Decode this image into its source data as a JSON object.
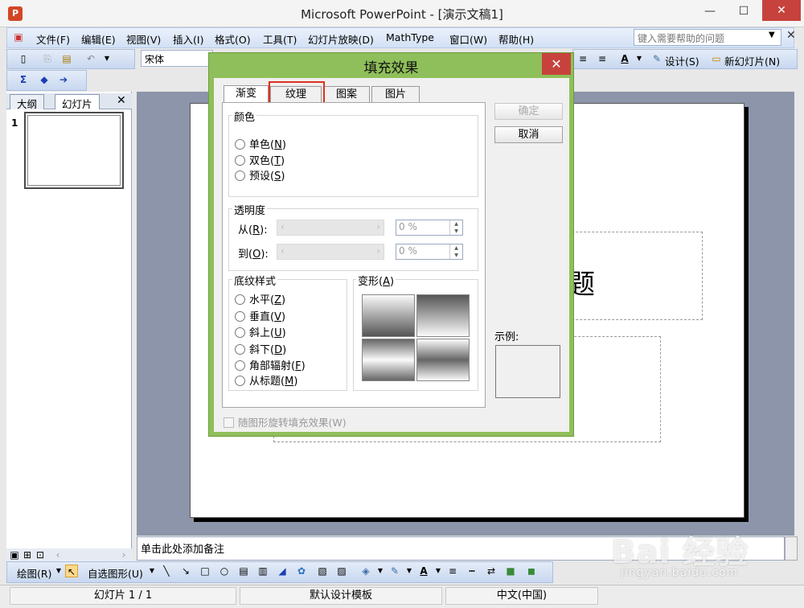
{
  "window": {
    "title": "Microsoft PowerPoint - [演示文稿1]",
    "minimize": "—",
    "maximize": "☐",
    "close": "✕"
  },
  "menu": {
    "items": [
      "文件(F)",
      "编辑(E)",
      "视图(V)",
      "插入(I)",
      "格式(O)",
      "工具(T)",
      "幻灯片放映(D)",
      "MathType",
      "窗口(W)",
      "帮助(H)"
    ],
    "help_placeholder": "键入需要帮助的问题",
    "close": "✕"
  },
  "toolbar": {
    "font_name": "宋体",
    "design_label": "设计(S)",
    "new_slide_label": "新幻灯片(N)",
    "sigma": "Σ"
  },
  "left_panel": {
    "tab_outline": "大纲",
    "tab_slides": "幻灯片",
    "close": "✕",
    "slide_number": "1"
  },
  "slide": {
    "title_fragment": "题"
  },
  "notes": {
    "text": "单击此处添加备注"
  },
  "drawbar": {
    "draw_label": "绘图(R)",
    "autoshape_label": "自选图形(U)"
  },
  "status": {
    "slide_info": "幻灯片 1 / 1",
    "template": "默认设计模板",
    "language": "中文(中国)"
  },
  "dialog": {
    "title": "填充效果",
    "close": "✕",
    "tabs": [
      "渐变",
      "纹理",
      "图案",
      "图片"
    ],
    "active_tab": "渐变",
    "highlighted_tab": "纹理",
    "color_group": {
      "label": "颜色",
      "options": [
        {
          "text": "单色",
          "key": "N"
        },
        {
          "text": "双色",
          "key": "T"
        },
        {
          "text": "预设",
          "key": "S"
        }
      ]
    },
    "transparency": {
      "label": "透明度",
      "from_label": "从",
      "from_key": "R",
      "to_label": "到",
      "to_key": "O",
      "from_value": "0 %",
      "to_value": "0 %"
    },
    "shading_group": {
      "label": "底纹样式",
      "options": [
        {
          "text": "水平",
          "key": "Z"
        },
        {
          "text": "垂直",
          "key": "V"
        },
        {
          "text": "斜上",
          "key": "U"
        },
        {
          "text": "斜下",
          "key": "D"
        },
        {
          "text": "角部辐射",
          "key": "F"
        },
        {
          "text": "从标题",
          "key": "M"
        }
      ]
    },
    "variants": {
      "label": "变形",
      "key": "A"
    },
    "ok": "确定",
    "cancel": "取消",
    "sample_label": "示例:",
    "rotate_checkbox": "随图形旋转填充效果(W)"
  },
  "watermark": {
    "logo": "Bai 经验",
    "url": "jingyan.baidu.com"
  },
  "colors": {
    "dialog_frame": "#8fbf5a",
    "close_red": "#c7423c",
    "highlight_red": "#e0301e",
    "canvas_bg": "#8c95a9"
  }
}
